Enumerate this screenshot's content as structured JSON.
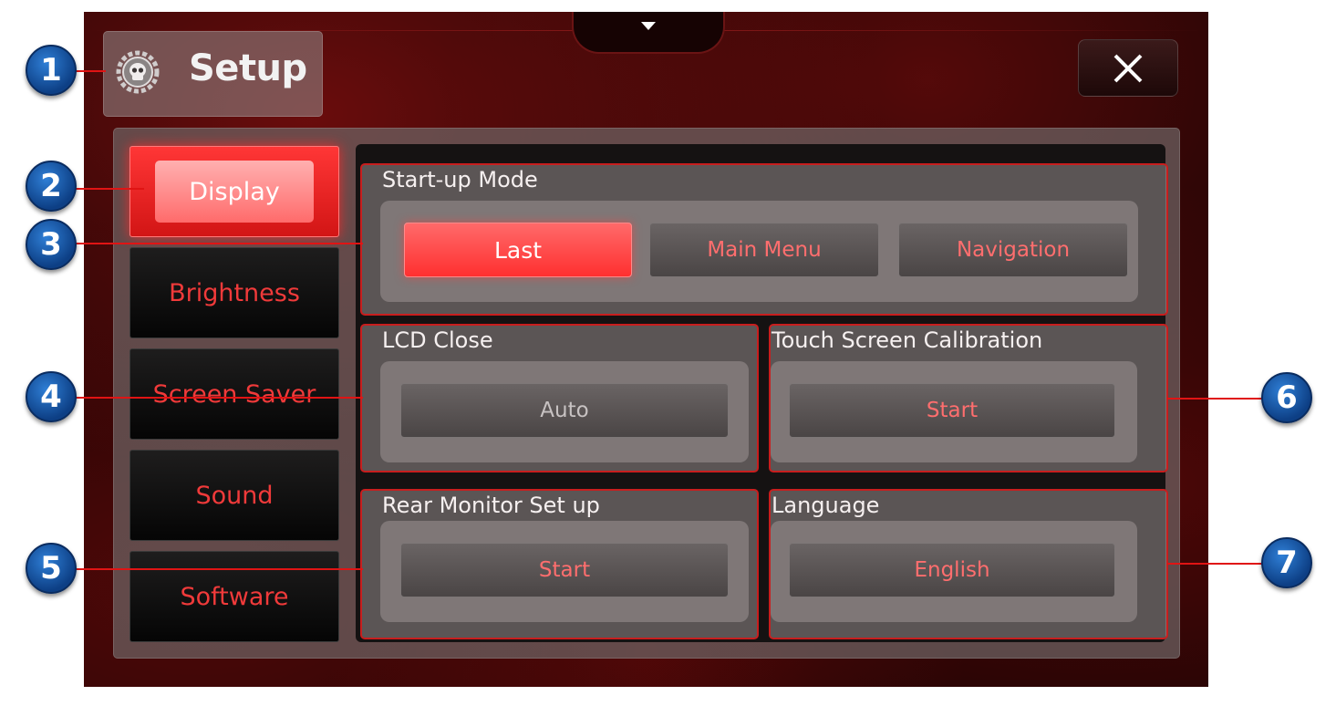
{
  "header": {
    "title": "Setup",
    "close_label": "✕"
  },
  "sidebar": {
    "items": [
      {
        "label": "Display",
        "active": true
      },
      {
        "label": "Brightness",
        "active": false
      },
      {
        "label": "Screen Saver",
        "active": false
      },
      {
        "label": "Sound",
        "active": false
      },
      {
        "label": "Software",
        "active": false
      }
    ]
  },
  "groups": {
    "startup_mode": {
      "title": "Start-up Mode",
      "options": [
        "Last",
        "Main Menu",
        "Navigation"
      ],
      "selected": "Last"
    },
    "lcd_close": {
      "title": "LCD Close",
      "value": "Auto"
    },
    "touch_calibration": {
      "title": "Touch Screen Calibration",
      "button": "Start"
    },
    "rear_monitor": {
      "title": "Rear Monitor Set up",
      "button": "Start"
    },
    "language": {
      "title": "Language",
      "value": "English"
    }
  },
  "callouts": [
    "1",
    "2",
    "3",
    "4",
    "5",
    "6",
    "7"
  ],
  "colors": {
    "accent_red": "#ff3030",
    "callout_blue": "#1a5bb0"
  }
}
